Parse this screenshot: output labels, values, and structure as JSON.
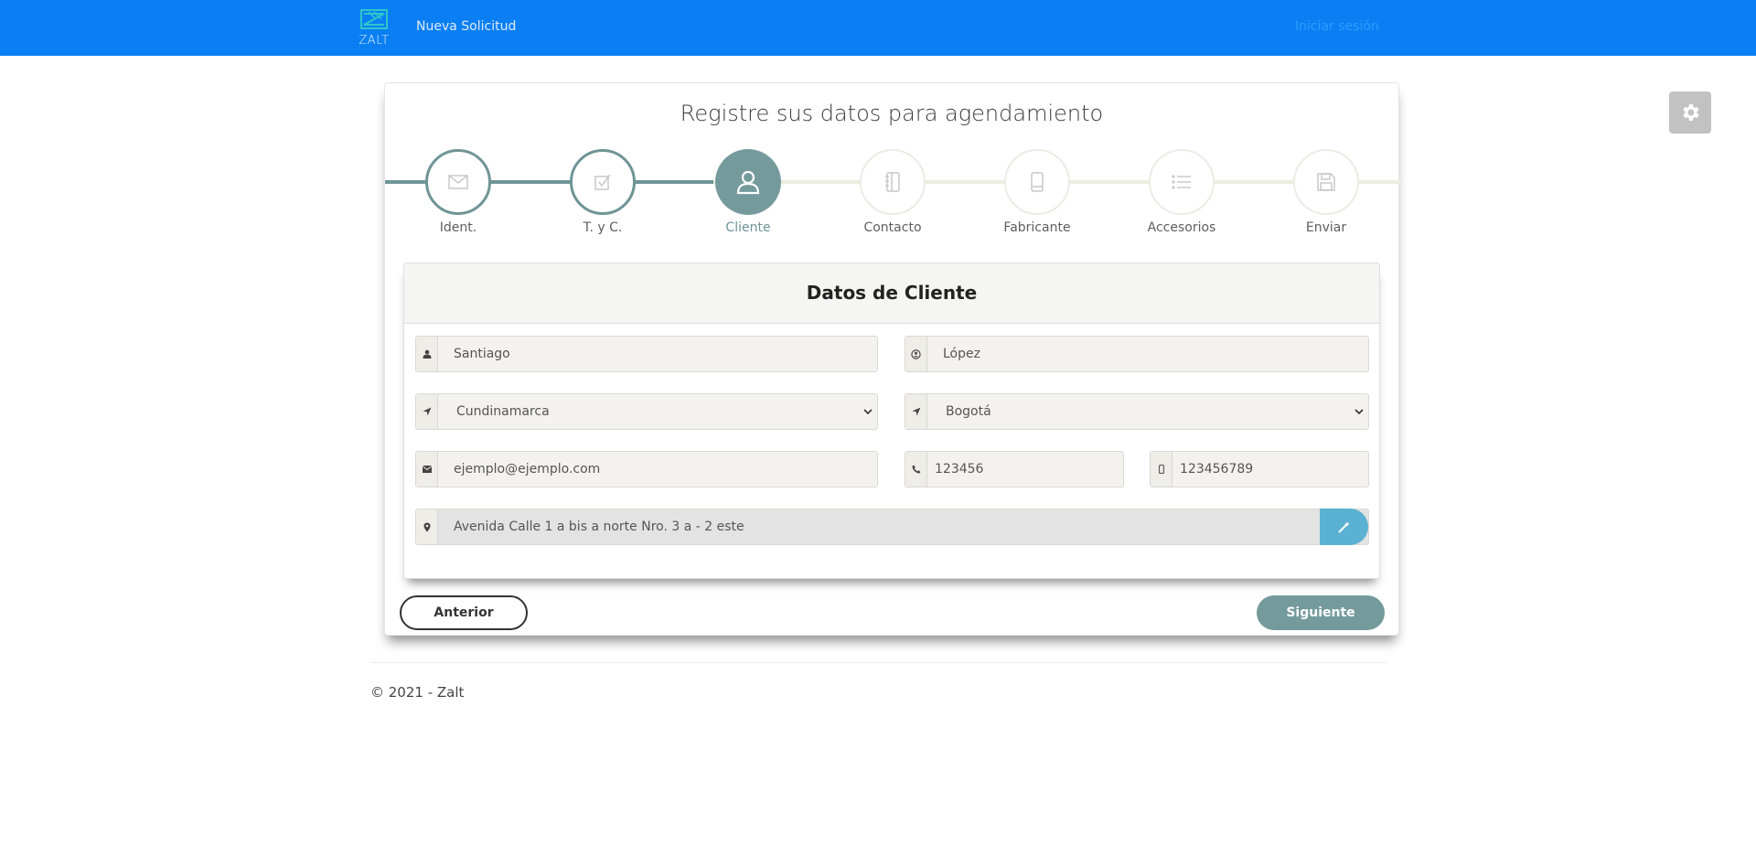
{
  "navbar": {
    "brand_text": "ZALT",
    "new_request": "Nueva Solicitud",
    "login": "Iniciar sesión",
    "colors": {
      "background": "#0a7ff4",
      "brand": "#2ec7c9"
    }
  },
  "form": {
    "title": "Registre sus datos para agendamiento",
    "steps": [
      {
        "label": "Ident.",
        "icon": "envelope-icon",
        "state": "done"
      },
      {
        "label": "T. y C.",
        "icon": "checkbox-icon",
        "state": "done"
      },
      {
        "label": "Cliente",
        "icon": "user-icon",
        "state": "current"
      },
      {
        "label": "Contacto",
        "icon": "contact-book-icon",
        "state": "todo"
      },
      {
        "label": "Fabricante",
        "icon": "mobile-icon",
        "state": "todo"
      },
      {
        "label": "Accesorios",
        "icon": "list-icon",
        "state": "todo"
      },
      {
        "label": "Enviar",
        "icon": "save-icon",
        "state": "todo"
      }
    ],
    "panel_title": "Datos de Cliente",
    "fields": {
      "first_name": "Santiago",
      "last_name": "López",
      "department": "Cundinamarca",
      "city": "Bogotá",
      "email": "ejemplo@ejemplo.com",
      "phone": "123456",
      "mobile": "123456789",
      "address": "Avenida Calle  1  a  bis  a  norte  Nro. 3 a - 2 este"
    },
    "buttons": {
      "previous": "Anterior",
      "next": "Siguiente"
    },
    "colors": {
      "accent": "#759a9c",
      "address_button": "#5ab1d1"
    }
  },
  "footer": {
    "copyright": "© 2021 - Zalt"
  }
}
